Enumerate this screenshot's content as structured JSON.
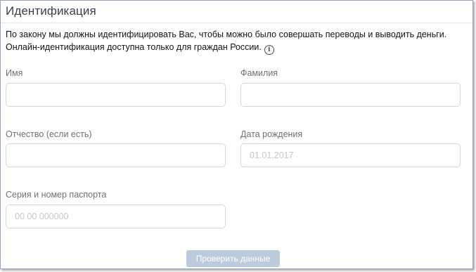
{
  "form": {
    "title": "Идентификация",
    "description_line1": "По закону мы должны идентифицировать Вас, чтобы можно было совершать переводы и выводить деньги.",
    "description_line2": "Онлайн-идентификация доступна только для граждан России.",
    "info_icon": "info-icon",
    "fields": {
      "first_name": {
        "label": "Имя",
        "value": "",
        "placeholder": ""
      },
      "last_name": {
        "label": "Фамилия",
        "value": "",
        "placeholder": ""
      },
      "middle_name": {
        "label": "Отчество (если есть)",
        "value": "",
        "placeholder": ""
      },
      "birth_date": {
        "label": "Дата рождения",
        "value": "",
        "placeholder": "01.01.2017"
      },
      "passport": {
        "label": "Серия и номер паспорта",
        "value": "",
        "placeholder": "00 00 000000"
      }
    },
    "submit_label": "Проверить данные"
  },
  "colors": {
    "border": "#d3d8de",
    "label": "#6b7178",
    "button_disabled": "#bccbdc"
  }
}
